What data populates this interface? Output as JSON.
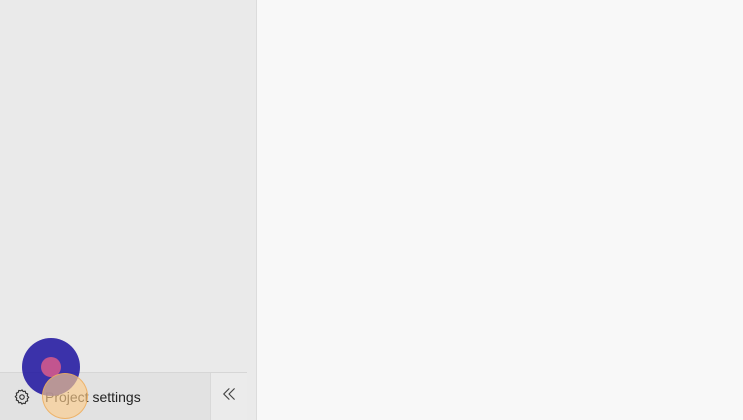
{
  "sidebar": {
    "footer": {
      "settings_label": "Project settings",
      "settings_icon": "gear-icon",
      "collapse_icon": "double-chevron-left-icon"
    }
  },
  "colors": {
    "sidebar_bg": "#eaeaea",
    "main_bg": "#f8f8f8",
    "click_indicator": "#2218a0",
    "click_center": "#c2558f",
    "cursor_highlight": "#fccd8c"
  }
}
